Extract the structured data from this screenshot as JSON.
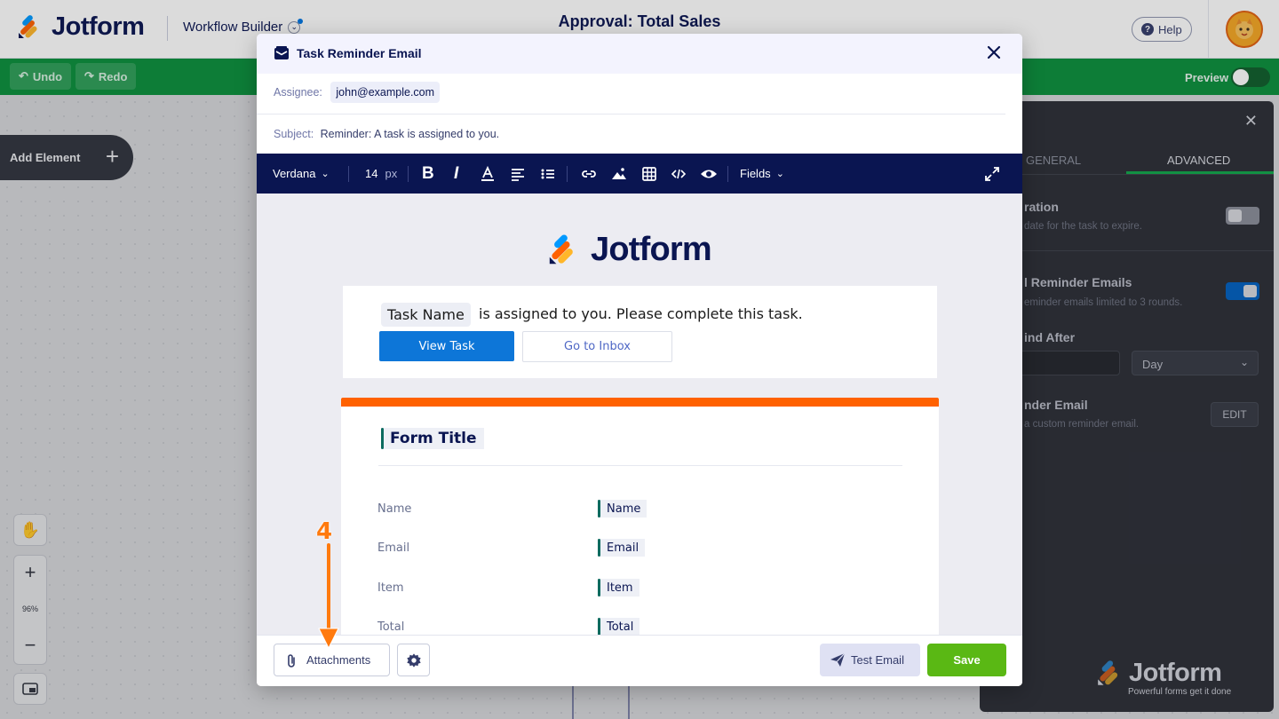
{
  "app": {
    "logo_text": "Jotform",
    "section": "Workflow Builder",
    "title": "Approval: Total Sales",
    "help_label": "Help",
    "undo_label": "Undo",
    "redo_label": "Redo",
    "preview_label": "Preview",
    "add_element_label": "Add Element",
    "zoom_level": "96%"
  },
  "right_panel": {
    "tabs": [
      "GENERAL",
      "ADVANCED"
    ],
    "active_tab": "ADVANCED",
    "sections": [
      {
        "label": "ration",
        "sub": "date for the task to expire.",
        "toggle_on": false
      },
      {
        "label": "l Reminder Emails",
        "sub": "eminder emails limited to 3 rounds.",
        "toggle_on": true
      },
      {
        "label": "ind After"
      },
      {
        "label": "nder Email",
        "sub": "a custom reminder email."
      }
    ],
    "remind_unit": "Day",
    "edit_label": "EDIT",
    "brand": "Jotform",
    "brand_tagline": "Powerful forms get it done"
  },
  "modal": {
    "title": "Task Reminder Email",
    "assignee_label": "Assignee:",
    "assignee_value": "john@example.com",
    "subject_label": "Subject:",
    "subject_value": "Reminder: A task is assigned to you.",
    "toolbar": {
      "font": "Verdana",
      "size": "14",
      "size_unit": "px",
      "fields_label": "Fields"
    },
    "email": {
      "logo_text": "Jotform",
      "task_name_chip": "Task Name",
      "task_text": "is assigned to you. Please complete this task.",
      "view_task_label": "View Task",
      "go_inbox_label": "Go to Inbox",
      "form_title": "Form Title",
      "fields": [
        {
          "label": "Name",
          "value": "Name"
        },
        {
          "label": "Email",
          "value": "Email"
        },
        {
          "label": "Item",
          "value": "Item"
        },
        {
          "label": "Total",
          "value": "Total"
        }
      ]
    },
    "footer": {
      "attachments_label": "Attachments",
      "test_email_label": "Test Email",
      "save_label": "Save"
    }
  },
  "annotation": {
    "step_number": "4"
  },
  "colors": {
    "brand_navy": "#0a1551",
    "green_bar": "#0a8f3c",
    "save_green": "#5ab814",
    "accent_orange": "#ff6100",
    "link_blue": "#0d76d8"
  }
}
